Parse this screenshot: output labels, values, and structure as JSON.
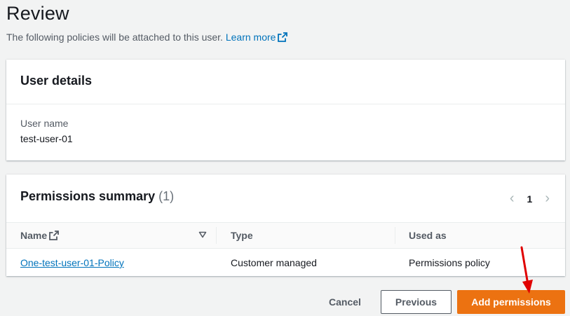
{
  "page": {
    "title": "Review",
    "subtitle": "The following policies will be attached to this user.",
    "learn_more": "Learn more"
  },
  "user_details": {
    "heading": "User details",
    "user_name_label": "User name",
    "user_name_value": "test-user-01"
  },
  "permissions": {
    "heading": "Permissions summary",
    "count": "(1)",
    "pagination": {
      "current_page": "1"
    },
    "columns": [
      "Name",
      "Type",
      "Used as"
    ],
    "rows": [
      {
        "name": "One-test-user-01-Policy",
        "type": "Customer managed",
        "used_as": "Permissions policy"
      }
    ]
  },
  "actions": {
    "cancel": "Cancel",
    "previous": "Previous",
    "add_permissions": "Add permissions"
  },
  "colors": {
    "primary_button": "#ec7211",
    "link": "#0073bb",
    "annotation_arrow": "#e00000"
  },
  "icons": [
    "external-link-icon",
    "chevron-left-icon",
    "chevron-right-icon",
    "sort-caret-icon",
    "annotation-arrow-icon"
  ]
}
